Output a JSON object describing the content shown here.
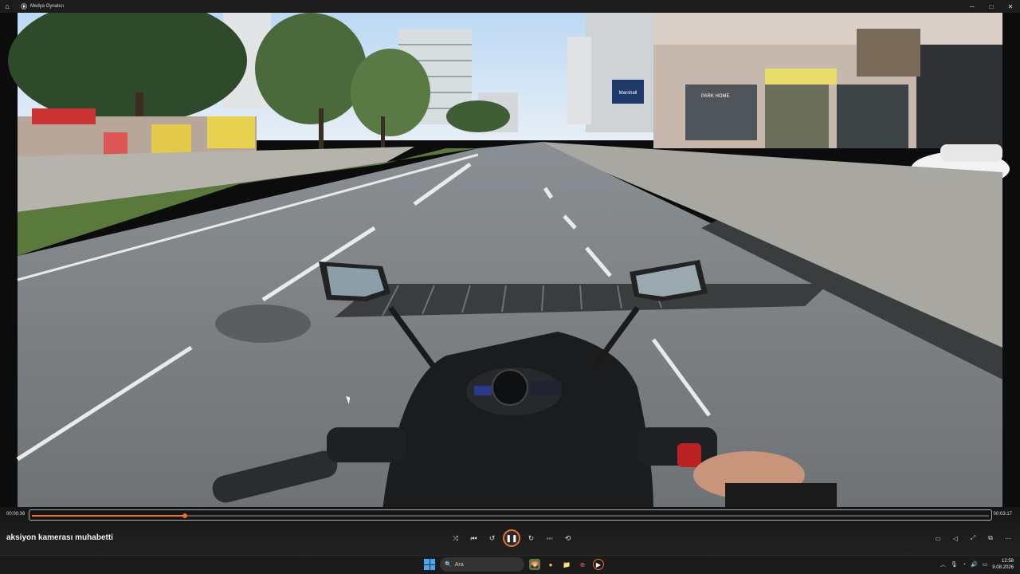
{
  "window": {
    "title": "Medya Oynatıcı",
    "home_icon": "home-icon",
    "controls": {
      "minimize": "─",
      "maximize": "□",
      "close": "✕"
    }
  },
  "video": {
    "description_icon": "motorcycle-pov-frame",
    "plates": {
      "shop_sign": "Marshall",
      "store_name": "PARK HOME"
    }
  },
  "player": {
    "elapsed": "00:00:36",
    "duration": "00:03:17",
    "progress_fraction": 0.16,
    "media_title": "aksiyon kamerası muhabetti",
    "accent_color": "#e8712a",
    "buttons": {
      "shuffle": "⤨",
      "previous": "⏮",
      "rewind": "↺",
      "play_pause": "❚❚",
      "forward": "↻",
      "next": "⏭",
      "repeat": "⟲"
    },
    "right_buttons": {
      "subtitles": "▭",
      "volume": "◁",
      "fullscreen": "⤢",
      "miniplayer": "⧉",
      "more": "⋯"
    }
  },
  "taskbar": {
    "search_placeholder": "Ara",
    "search_icon": "🔍",
    "apps": [
      "🌄",
      "●",
      "📁",
      "⊕",
      "▶"
    ],
    "tray": {
      "chevron": "︿",
      "mic": "🎙",
      "wifi": "◔",
      "volume": "🔊",
      "battery": "▭"
    },
    "time": "12:58",
    "date": "9.08.2026"
  }
}
